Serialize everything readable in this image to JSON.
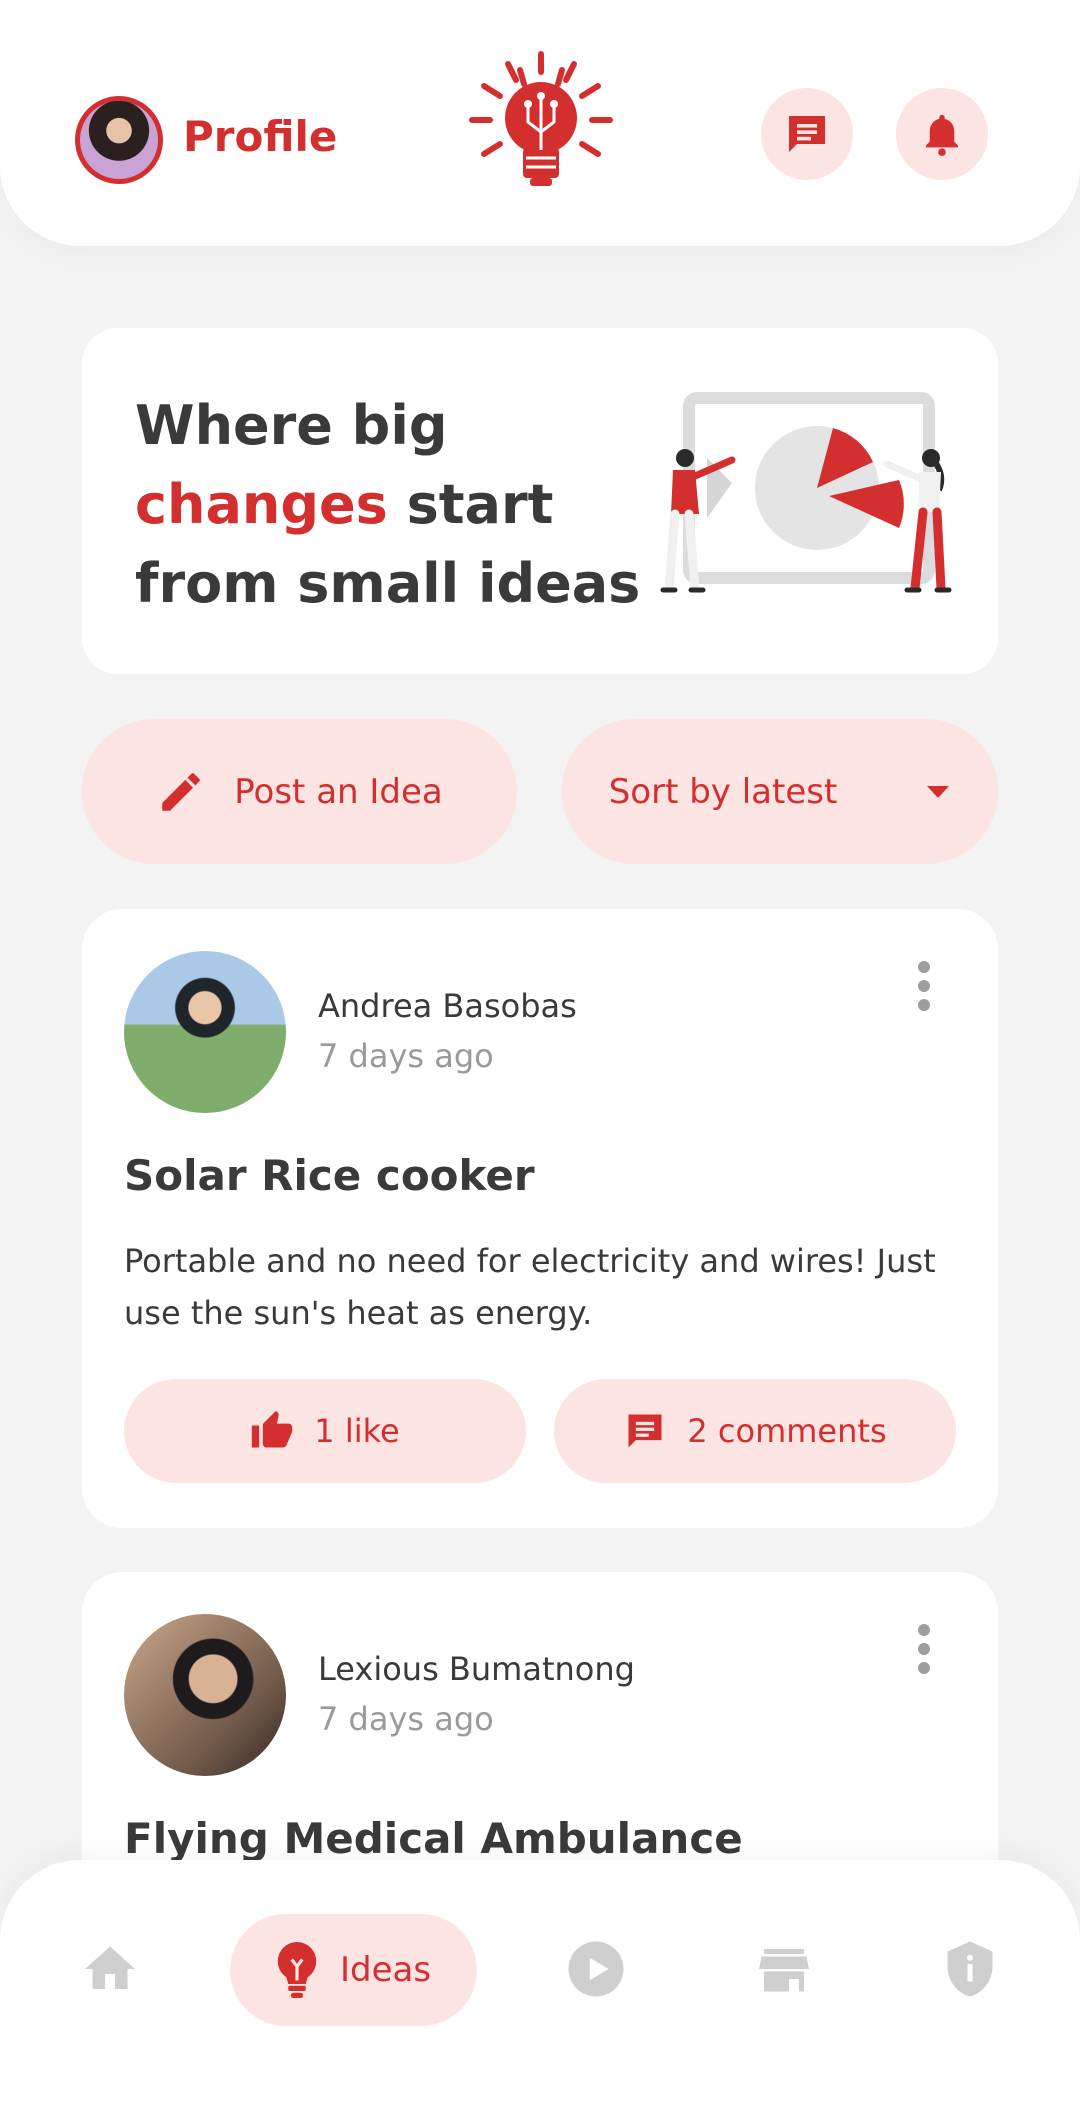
{
  "header": {
    "profile_label": "Profile",
    "logo_icon": "lightbulb-sun-logo",
    "messages_icon": "chat-icon",
    "notifications_icon": "bell-icon"
  },
  "hero": {
    "line1": "Where big",
    "accent": "changes",
    "line2_rest": " start",
    "line3": "from small ideas"
  },
  "actions": {
    "post_label": "Post an Idea",
    "sort_label": "Sort by latest"
  },
  "ideas": [
    {
      "author": "Andrea Basobas",
      "time": "7 days ago",
      "title": "Solar Rice cooker",
      "description": "Portable and no need for electricity and wires! Just use the sun's heat as energy.",
      "likes_label": "1 like",
      "comments_label": "2 comments"
    },
    {
      "author": "Lexious Bumatnong",
      "time": "7 days ago",
      "title": "Flying Medical Ambulance"
    }
  ],
  "nav": {
    "active_label": "Ideas",
    "items": [
      "home-icon",
      "ideas-icon",
      "play-icon",
      "store-icon",
      "shield-icon"
    ]
  },
  "colors": {
    "accent": "#d32f2f",
    "accent_soft": "#fbe4e2",
    "background": "#f3f3f3",
    "text": "#3a3a3a",
    "muted": "#9a9a9a"
  }
}
